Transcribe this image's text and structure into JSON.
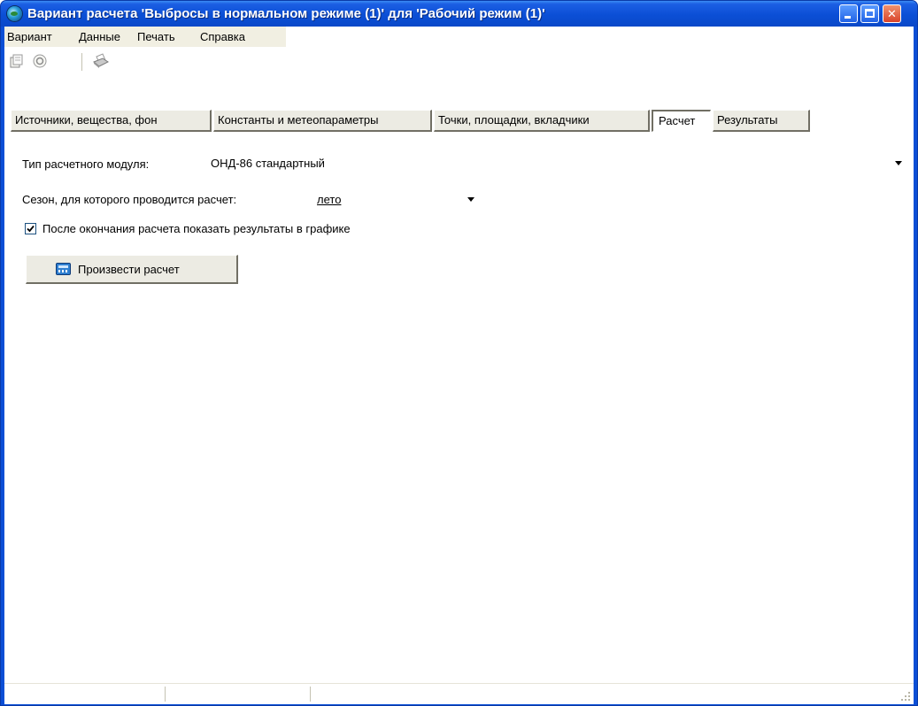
{
  "window": {
    "title": "Вариант расчета 'Выбросы в нормальном режиме (1)' для  'Рабочий режим (1)'",
    "icon": "globe-icon",
    "controls": [
      "minimize-icon",
      "maximize-icon",
      "close-icon"
    ],
    "close_glyph": "✕"
  },
  "menu": {
    "items": [
      "Вариант",
      "Данные",
      "Печать",
      "Справка"
    ]
  },
  "toolbar": {
    "icons": [
      "open-icon",
      "run-icon",
      "print-icon"
    ]
  },
  "tabs": [
    {
      "label": "Источники, вещества, фон",
      "active": false
    },
    {
      "label": "Константы и метеопараметры",
      "active": false
    },
    {
      "label": "Точки, площадки, вкладчики",
      "active": false
    },
    {
      "label": "Расчет",
      "active": true
    },
    {
      "label": "Результаты",
      "active": false
    }
  ],
  "calc": {
    "module_label": "Тип расчетного модуля:",
    "module_value": "ОНД-86 стандартный",
    "season_label": "Сезон, для которого проводится расчет:",
    "season_value": "лето",
    "show_results_label": "После окончания расчета показать результаты в графике",
    "show_results_checked": true,
    "run_button_label": "Произвести расчет",
    "run_button_icon": "calculator-icon"
  },
  "colors": {
    "titlebar": "#0b4fd6",
    "close_button": "#d9442a",
    "face": "#ecebe3"
  }
}
